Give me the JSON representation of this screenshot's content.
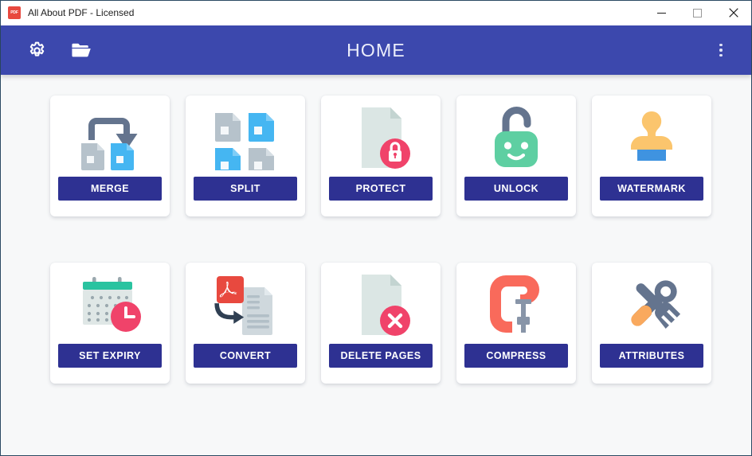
{
  "window": {
    "title": "All About PDF - Licensed",
    "app_icon": "pdf-app-icon",
    "controls": {
      "minimize": "minimize-button",
      "maximize": "maximize-button",
      "close": "close-button"
    }
  },
  "appbar": {
    "title": "HOME",
    "settings_icon": "gear-icon",
    "open_folder_icon": "folder-icon",
    "overflow_icon": "more-vertical-icon",
    "background_color": "#3c48ad"
  },
  "theme": {
    "accent": "#2e3192",
    "header": "#3c48ad",
    "content_bg": "#f7f8f9",
    "card_bg": "#ffffff",
    "doc_blue": "#45b6f2",
    "doc_gray": "#b6c2cb",
    "badge_pink": "#f0436a",
    "green": "#5ecfa2",
    "teal": "#2ac3a0",
    "orange": "#fbc56d",
    "blue_base": "#3f93e0",
    "coral": "#f96a5b",
    "pdf_red": "#e8493f",
    "slate": "#64748e"
  },
  "tools": [
    {
      "id": "merge",
      "label": "MERGE",
      "icon": "merge-documents-icon"
    },
    {
      "id": "split",
      "label": "SPLIT",
      "icon": "split-documents-icon"
    },
    {
      "id": "protect",
      "label": "PROTECT",
      "icon": "document-lock-icon"
    },
    {
      "id": "unlock",
      "label": "UNLOCK",
      "icon": "open-padlock-smiley-icon"
    },
    {
      "id": "watermark",
      "label": "WATERMARK",
      "icon": "rubber-stamp-icon"
    },
    {
      "id": "set-expiry",
      "label": "SET EXPIRY",
      "icon": "calendar-clock-icon"
    },
    {
      "id": "convert",
      "label": "CONVERT",
      "icon": "pdf-convert-arrow-icon"
    },
    {
      "id": "delete-pages",
      "label": "DELETE PAGES",
      "icon": "document-delete-icon"
    },
    {
      "id": "compress",
      "label": "COMPRESS",
      "icon": "c-clamp-icon"
    },
    {
      "id": "attributes",
      "label": "ATTRIBUTES",
      "icon": "wrench-screwdriver-icon"
    }
  ]
}
